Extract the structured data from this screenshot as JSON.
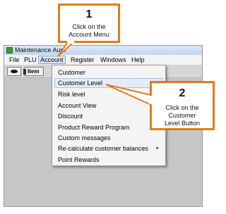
{
  "window": {
    "title": "Maintenance  Aum"
  },
  "menubar": {
    "items": [
      {
        "label": "File"
      },
      {
        "label": "PLU"
      },
      {
        "label": "Account"
      },
      {
        "label": "Register"
      },
      {
        "label": "Windows"
      },
      {
        "label": "Help"
      }
    ]
  },
  "toolbar": {
    "item_label": "Item"
  },
  "account_menu": {
    "items": [
      {
        "label": "Customer"
      },
      {
        "label": "Customer Level"
      },
      {
        "label": "Risk level"
      },
      {
        "label": "Account View"
      },
      {
        "label": "Discount"
      },
      {
        "label": "Product Reward Program"
      },
      {
        "label": "Custom messages"
      },
      {
        "label": "Re-calculate customer balances",
        "submenu": "▸"
      },
      {
        "label": "Point Rewards"
      }
    ]
  },
  "callouts": {
    "step1": {
      "number": "1",
      "line1": "Click on the",
      "line2": "Account Menu"
    },
    "step2": {
      "number": "2",
      "line1": "Click on the Customer",
      "line2": "Level Button"
    }
  },
  "colors": {
    "callout_border": "#e07b1f",
    "menu_highlight": "#e3ecf8"
  }
}
